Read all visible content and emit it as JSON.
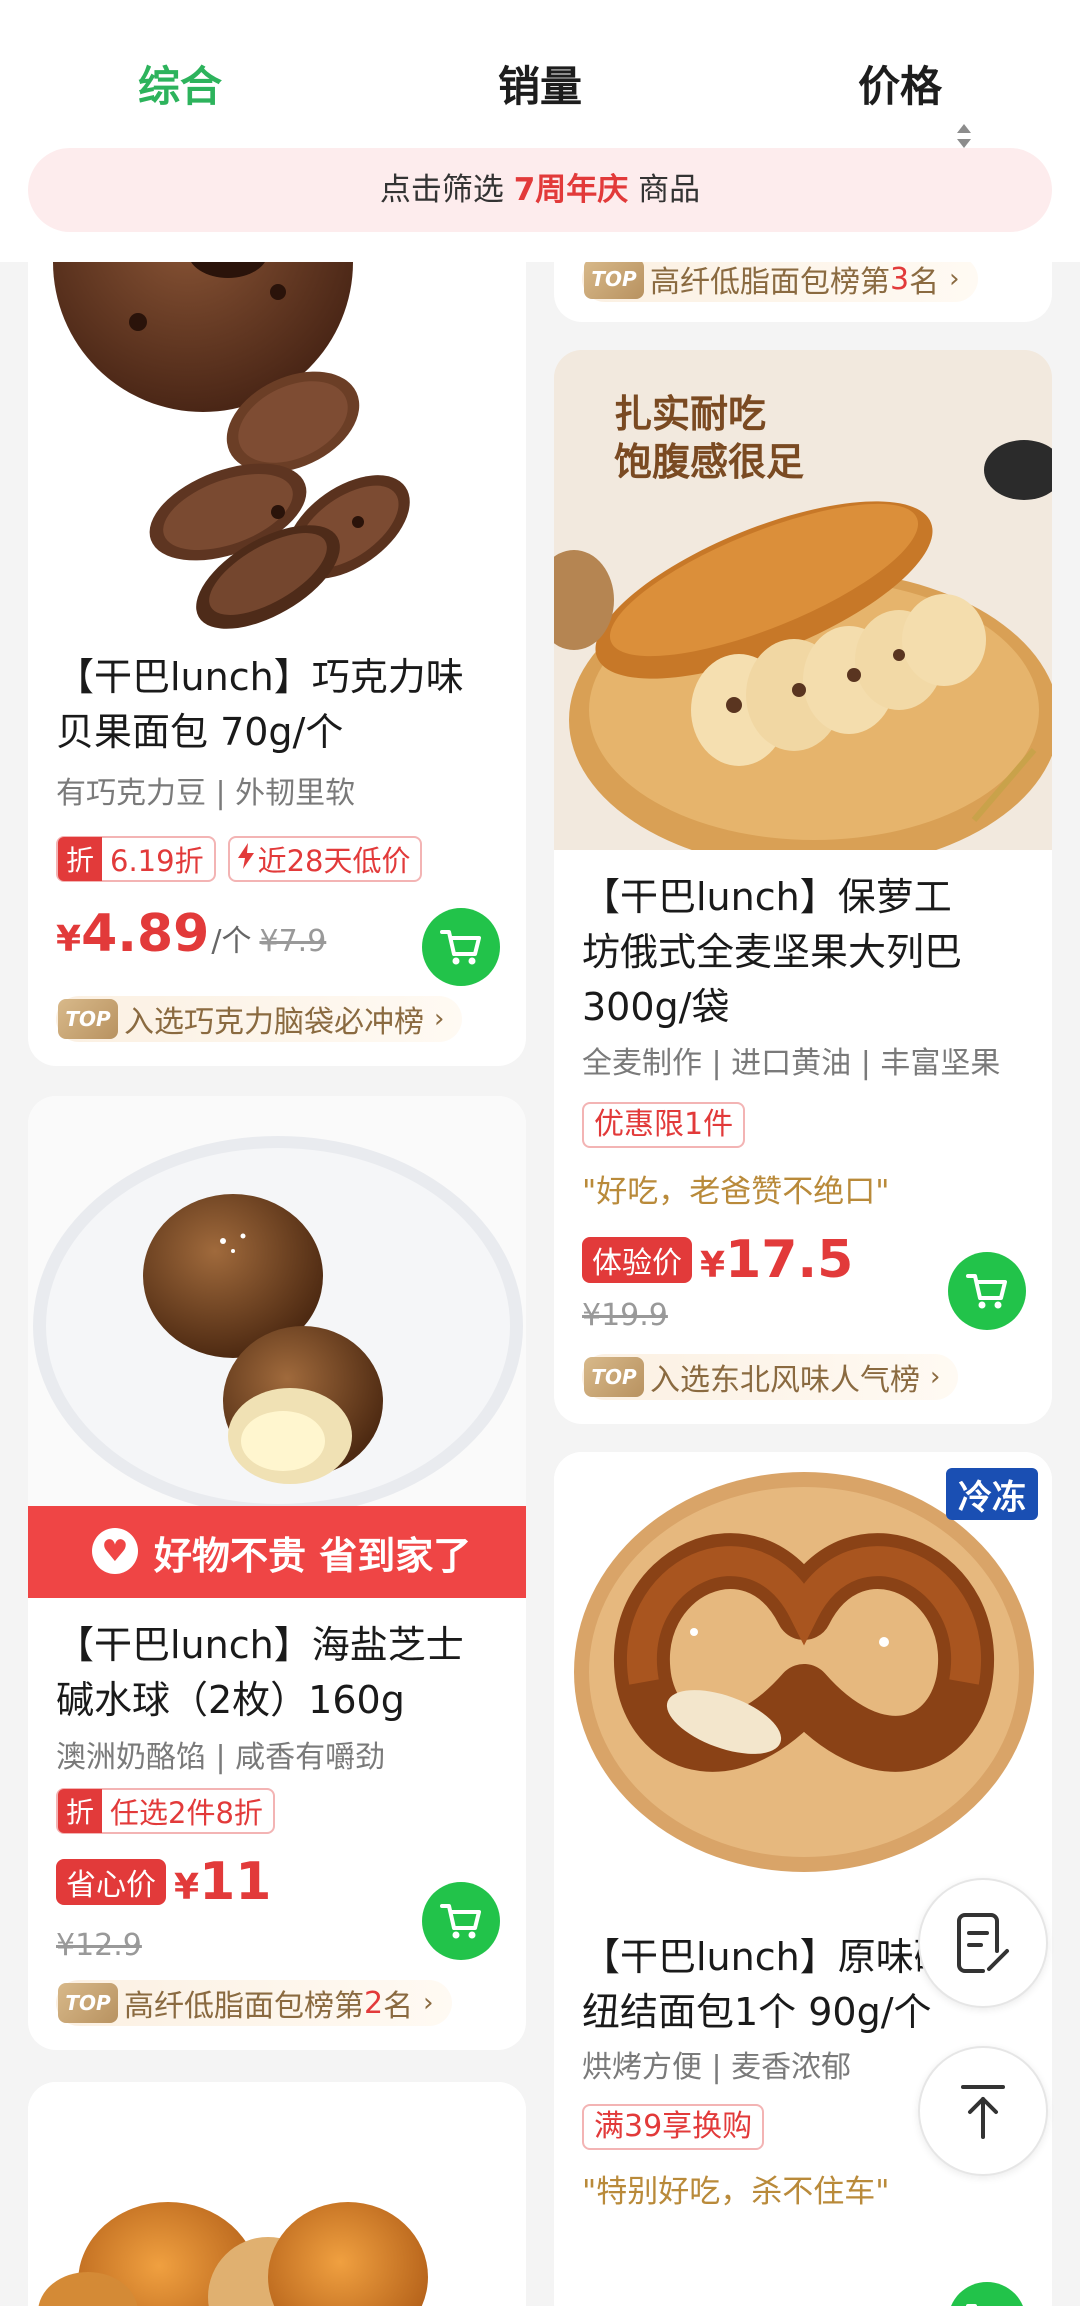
{
  "tabs": {
    "zonghe": "综合",
    "xiaoliang": "销量",
    "jiage": "价格"
  },
  "filter": {
    "prefix": "点击筛选",
    "highlight": "7周年庆",
    "suffix": "商品"
  },
  "colors": {
    "accent_green": "#2db35c",
    "price_red": "#e23a3a",
    "cart_green": "#22c34a",
    "frozen_blue": "#1a4fb3"
  },
  "left": {
    "bagel": {
      "title_line1": "【干巴lunch】巧克力味",
      "title_line2": "贝果面包 70g/个",
      "subtitle": "有巧克力豆 | 外韧里软",
      "tag_discount_icon": "折",
      "tag_discount_text": "6.19折",
      "tag_lowest": "近28天低价",
      "price_symbol": "¥",
      "price": "4.89",
      "price_unit": "/个",
      "price_old": "¥7.9",
      "rank_badge": "TOP",
      "rank_text": "入选巧克力脑袋必冲榜"
    },
    "cheese_ball": {
      "banner_text": "好物不贵 省到家了",
      "title_line1": "【干巴lunch】海盐芝士",
      "title_line2": "碱水球（2枚）160g",
      "subtitle": "澳洲奶酪馅 | 咸香有嚼劲",
      "tag_discount_icon": "折",
      "tag_discount_text": "任选2件8折",
      "price_badge": "省心价",
      "price_symbol": "¥",
      "price": "11",
      "price_old": "¥12.9",
      "rank_badge": "TOP",
      "rank_prefix": "高纤低脂面包榜第",
      "rank_number": "2",
      "rank_suffix": "名"
    }
  },
  "right": {
    "top_rank": {
      "rank_badge": "TOP",
      "rank_prefix": "高纤低脂面包榜第",
      "rank_number": "3",
      "rank_suffix": "名"
    },
    "lieba": {
      "image_text_line1": "扎实耐吃",
      "image_text_line2": "饱腹感很足",
      "title_line1": "【干巴lunch】保萝工",
      "title_line2": "坊俄式全麦坚果大列巴",
      "title_line3": "300g/袋",
      "subtitle": "全麦制作 | 进口黄油 | 丰富坚果",
      "promo_tag": "优惠限1件",
      "review": "\"好吃，老爸赞不绝口\"",
      "price_badge": "体验价",
      "price_symbol": "¥",
      "price": "17.5",
      "price_old": "¥19.9",
      "rank_badge": "TOP",
      "rank_text": "入选东北风味人气榜"
    },
    "pretzel": {
      "frozen_label": "冷冻",
      "title_line1": "【干巴lunch】原味碱水",
      "title_line2": "纽结面包1个 90g/个",
      "subtitle": "烘烤方便 | 麦香浓郁",
      "promo_tag": "满39享换购",
      "review": "\"特别好吃，杀不住车\""
    }
  },
  "icons": {
    "cart": "cart-icon",
    "notes": "notes-edit-icon",
    "back_to_top": "back-to-top-icon",
    "heart": "heart-icon",
    "chevron": "chevron-right-icon",
    "bolt": "lightning-icon"
  }
}
